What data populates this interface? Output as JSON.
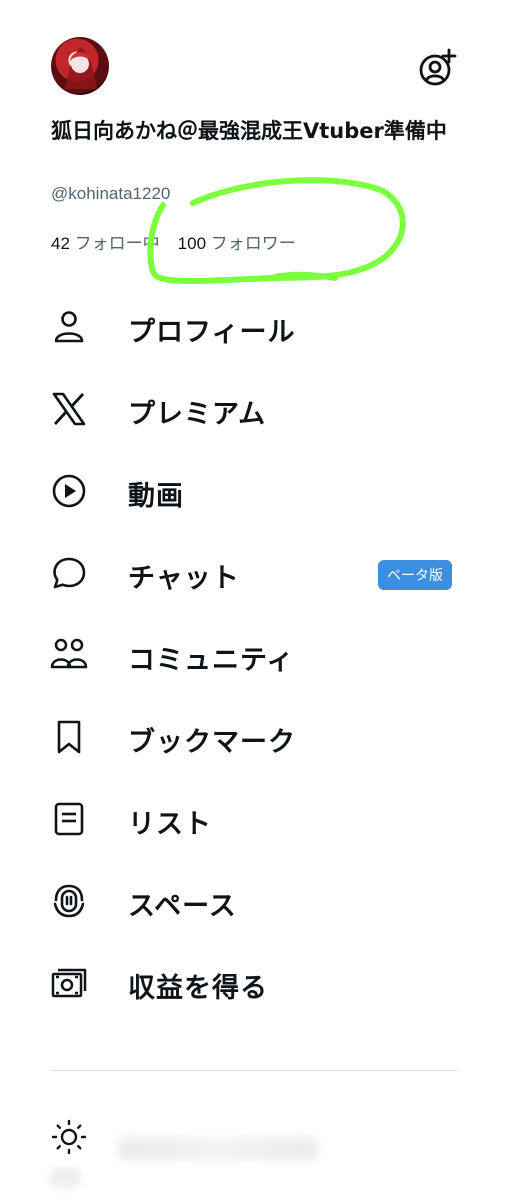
{
  "profile": {
    "display_name": "狐日向あかね＠最強混成王Vtuber準備中",
    "handle": "@kohinata1220",
    "following_count": "42",
    "following_label": "フォロー中",
    "followers_count": "100",
    "followers_label": "フォロワー"
  },
  "menu": {
    "items": [
      {
        "label": "プロフィール",
        "icon": "person-icon"
      },
      {
        "label": "プレミアム",
        "icon": "x-logo-icon"
      },
      {
        "label": "動画",
        "icon": "play-circle-icon"
      },
      {
        "label": "チャット",
        "icon": "chat-bubble-icon",
        "badge": "ベータ版"
      },
      {
        "label": "コミュニティ",
        "icon": "communities-icon"
      },
      {
        "label": "ブックマーク",
        "icon": "bookmark-icon"
      },
      {
        "label": "リスト",
        "icon": "list-icon"
      },
      {
        "label": "スペース",
        "icon": "spaces-mic-icon"
      },
      {
        "label": "収益を得る",
        "icon": "money-icon"
      }
    ]
  },
  "colors": {
    "text": "#0f1419",
    "secondary_text": "#536471",
    "badge": "#3b8fe0",
    "highlight_annotation": "#7cff3f"
  }
}
